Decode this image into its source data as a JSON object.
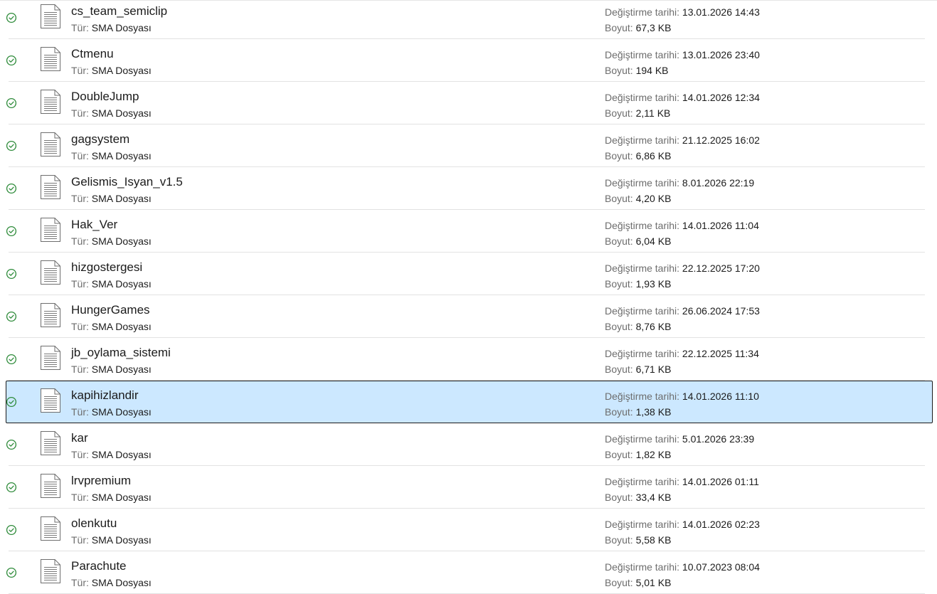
{
  "labels": {
    "type_label": "Tür:",
    "date_label": "Değiştirme tarihi:",
    "size_label": "Boyut:"
  },
  "files": [
    {
      "name": "cs_team_semiclip",
      "type": "SMA Dosyası",
      "modified": "13.01.2026 14:43",
      "size": "67,3 KB",
      "selected": false
    },
    {
      "name": "Ctmenu",
      "type": "SMA Dosyası",
      "modified": "13.01.2026 23:40",
      "size": "194 KB",
      "selected": false
    },
    {
      "name": "DoubleJump",
      "type": "SMA Dosyası",
      "modified": "14.01.2026 12:34",
      "size": "2,11 KB",
      "selected": false
    },
    {
      "name": "gagsystem",
      "type": "SMA Dosyası",
      "modified": "21.12.2025 16:02",
      "size": "6,86 KB",
      "selected": false
    },
    {
      "name": "Gelismis_Isyan_v1.5",
      "type": "SMA Dosyası",
      "modified": "8.01.2026 22:19",
      "size": "4,20 KB",
      "selected": false
    },
    {
      "name": "Hak_Ver",
      "type": "SMA Dosyası",
      "modified": "14.01.2026 11:04",
      "size": "6,04 KB",
      "selected": false
    },
    {
      "name": "hizgostergesi",
      "type": "SMA Dosyası",
      "modified": "22.12.2025 17:20",
      "size": "1,93 KB",
      "selected": false
    },
    {
      "name": "HungerGames",
      "type": "SMA Dosyası",
      "modified": "26.06.2024 17:53",
      "size": "8,76 KB",
      "selected": false
    },
    {
      "name": "jb_oylama_sistemi",
      "type": "SMA Dosyası",
      "modified": "22.12.2025 11:34",
      "size": "6,71 KB",
      "selected": false
    },
    {
      "name": "kapihizlandir",
      "type": "SMA Dosyası",
      "modified": "14.01.2026 11:10",
      "size": "1,38 KB",
      "selected": true
    },
    {
      "name": "kar",
      "type": "SMA Dosyası",
      "modified": "5.01.2026 23:39",
      "size": "1,82 KB",
      "selected": false
    },
    {
      "name": "lrvpremium",
      "type": "SMA Dosyası",
      "modified": "14.01.2026 01:11",
      "size": "33,4 KB",
      "selected": false
    },
    {
      "name": "olenkutu",
      "type": "SMA Dosyası",
      "modified": "14.01.2026 02:23",
      "size": "5,58 KB",
      "selected": false
    },
    {
      "name": "Parachute",
      "type": "SMA Dosyası",
      "modified": "10.07.2023 08:04",
      "size": "5,01 KB",
      "selected": false
    }
  ],
  "icons": {
    "status": "sync-ok-check-circle-icon",
    "file": "document-file-icon"
  },
  "colors": {
    "status_green": "#2e8b3a",
    "selection_bg": "#cce8ff",
    "label_gray": "#6d6d6d"
  }
}
